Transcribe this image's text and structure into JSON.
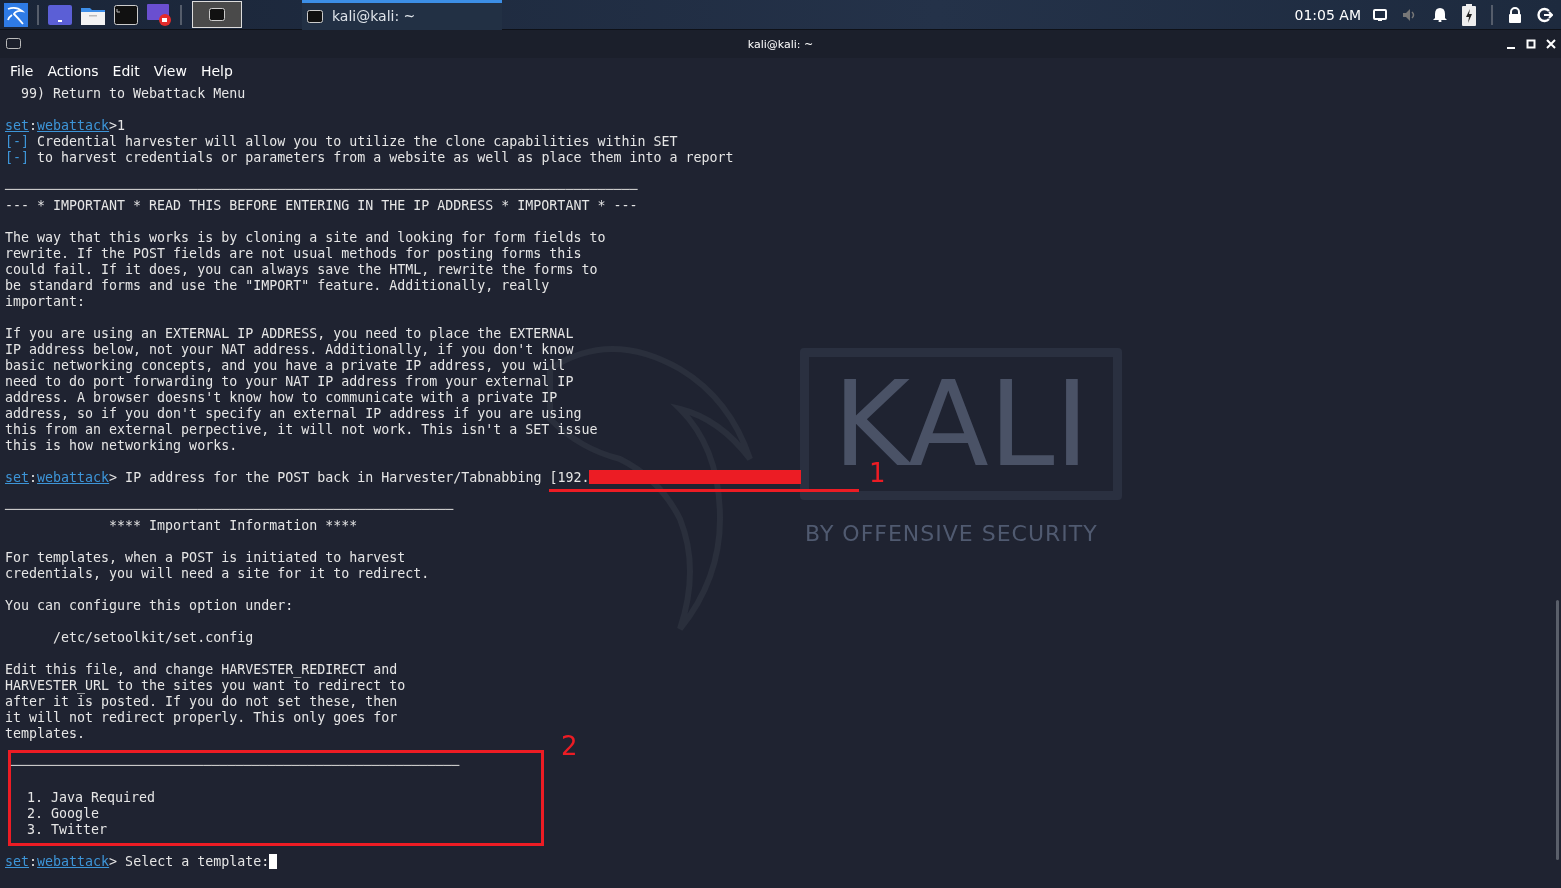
{
  "taskbar": {
    "launchers": [
      {
        "kind": "desktop"
      },
      {
        "kind": "files"
      },
      {
        "kind": "terminal"
      },
      {
        "kind": "recorder"
      }
    ],
    "workspace": {
      "selected": true
    },
    "task": {
      "title": "kali@kali: ~",
      "selected": true
    },
    "clock": "01:05 AM",
    "tray": [
      {
        "kind": "display"
      },
      {
        "kind": "volume",
        "muted": true
      },
      {
        "kind": "bell"
      },
      {
        "kind": "battery"
      },
      {
        "kind": "lock"
      },
      {
        "kind": "logout"
      }
    ]
  },
  "window": {
    "title": "kali@kali: ~",
    "menu": [
      "File",
      "Actions",
      "Edit",
      "View",
      "Help"
    ]
  },
  "wallpaper": {
    "logo_text": "KALI",
    "tagline": "BY OFFENSIVE SECURITY"
  },
  "terminal": {
    "lines": [
      {
        "kind": "text",
        "text": "  99) Return to Webattack Menu"
      },
      {
        "kind": "blank"
      },
      {
        "kind": "prompt",
        "shell": "set",
        "sep": ":",
        "module": "webattack",
        "text": ">1"
      },
      {
        "kind": "info",
        "marker": "[-]",
        "text": " Credential harvester will allow you to utilize the clone capabilities within SET"
      },
      {
        "kind": "info",
        "marker": "[-]",
        "text": " to harvest credentials or parameters from a website as well as place them into a report"
      },
      {
        "kind": "blank"
      },
      {
        "kind": "rule",
        "text": "───────────────────────────────────────────────────────────────────────────────"
      },
      {
        "kind": "text",
        "text": "--- * IMPORTANT * READ THIS BEFORE ENTERING IN THE IP ADDRESS * IMPORTANT * ---"
      },
      {
        "kind": "blank"
      },
      {
        "kind": "text",
        "text": "The way that this works is by cloning a site and looking for form fields to"
      },
      {
        "kind": "text",
        "text": "rewrite. If the POST fields are not usual methods for posting forms this"
      },
      {
        "kind": "text",
        "text": "could fail. If it does, you can always save the HTML, rewrite the forms to"
      },
      {
        "kind": "text",
        "text": "be standard forms and use the \"IMPORT\" feature. Additionally, really"
      },
      {
        "kind": "text",
        "text": "important:"
      },
      {
        "kind": "blank"
      },
      {
        "kind": "text",
        "text": "If you are using an EXTERNAL IP ADDRESS, you need to place the EXTERNAL"
      },
      {
        "kind": "text",
        "text": "IP address below, not your NAT address. Additionally, if you don't know"
      },
      {
        "kind": "text",
        "text": "basic networking concepts, and you have a private IP address, you will"
      },
      {
        "kind": "text",
        "text": "need to do port forwarding to your NAT IP address from your external IP"
      },
      {
        "kind": "text",
        "text": "address. A browser doesns't know how to communicate with a private IP"
      },
      {
        "kind": "text",
        "text": "address, so if you don't specify an external IP address if you are using"
      },
      {
        "kind": "text",
        "text": "this from an external perpective, it will not work. This isn't a SET issue"
      },
      {
        "kind": "text",
        "text": "this is how networking works."
      },
      {
        "kind": "blank"
      },
      {
        "kind": "prompt",
        "shell": "set",
        "sep": ":",
        "module": "webattack",
        "text": "> IP address for the POST back in Harvester/Tabnabbing ",
        "value": "[192.",
        "redacted": true,
        "annotation": "1"
      },
      {
        "kind": "blank"
      },
      {
        "kind": "rule",
        "text": "────────────────────────────────────────────────────────"
      },
      {
        "kind": "text",
        "text": "             **** Important Information ****"
      },
      {
        "kind": "blank"
      },
      {
        "kind": "text",
        "text": "For templates, when a POST is initiated to harvest"
      },
      {
        "kind": "text",
        "text": "credentials, you will need a site for it to redirect."
      },
      {
        "kind": "blank"
      },
      {
        "kind": "text",
        "text": "You can configure this option under:"
      },
      {
        "kind": "blank"
      },
      {
        "kind": "text",
        "text": "      /etc/setoolkit/set.config"
      },
      {
        "kind": "blank"
      },
      {
        "kind": "text",
        "text": "Edit this file, and change HARVESTER_REDIRECT and"
      },
      {
        "kind": "text",
        "text": "HARVESTER_URL to the sites you want to redirect to"
      },
      {
        "kind": "text",
        "text": "after it is posted. If you do not set these, then"
      },
      {
        "kind": "text",
        "text": "it will not redirect properly. This only goes for"
      },
      {
        "kind": "text",
        "text": "templates."
      },
      {
        "kind": "blank"
      },
      {
        "kind": "annotated_group",
        "annotation": "2",
        "lines": [
          {
            "kind": "rule",
            "text": "────────────────────────────────────────────────────────"
          },
          {
            "kind": "blank"
          },
          {
            "kind": "text",
            "text": "  1. Java Required"
          },
          {
            "kind": "text",
            "text": "  2. Google"
          },
          {
            "kind": "text",
            "text": "  3. Twitter"
          }
        ]
      },
      {
        "kind": "blank"
      },
      {
        "kind": "prompt",
        "shell": "set",
        "sep": ":",
        "module": "webattack",
        "text": "> Select a template:",
        "cursor": true
      }
    ]
  }
}
